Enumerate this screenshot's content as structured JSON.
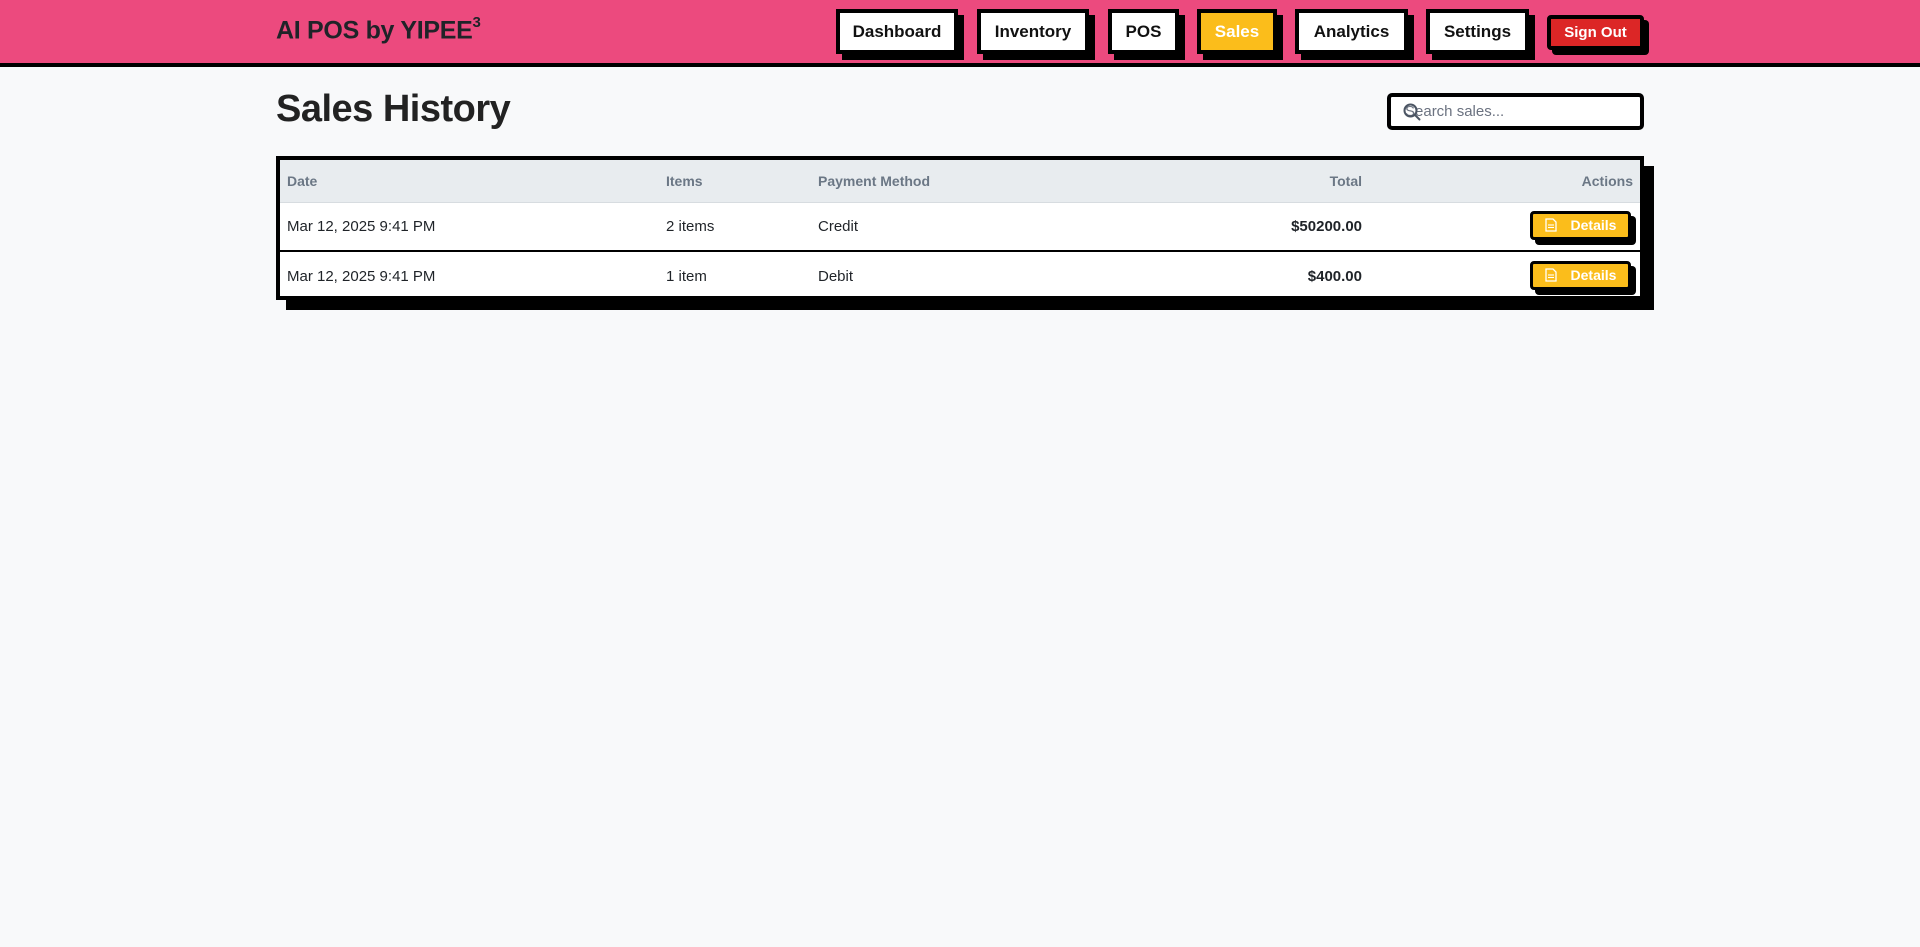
{
  "brand": {
    "name": "AI POS by YIPEE",
    "superscript": "3"
  },
  "nav": {
    "items": [
      {
        "label": "Dashboard",
        "active": false
      },
      {
        "label": "Inventory",
        "active": false
      },
      {
        "label": "POS",
        "active": false
      },
      {
        "label": "Sales",
        "active": true
      },
      {
        "label": "Analytics",
        "active": false
      },
      {
        "label": "Settings",
        "active": false
      }
    ],
    "sign_out_label": "Sign Out"
  },
  "page": {
    "title": "Sales History"
  },
  "search": {
    "placeholder": "Search sales...",
    "value": "",
    "icon": "search-icon"
  },
  "table": {
    "headers": [
      "Date",
      "Items",
      "Payment Method",
      "Total",
      "Actions"
    ],
    "rows": [
      {
        "date": "Mar 12, 2025 9:41 PM",
        "items": "2 items",
        "payment": "Credit",
        "total": "$50200.00",
        "action_label": "Details"
      },
      {
        "date": "Mar 12, 2025 9:41 PM",
        "items": "1 item",
        "payment": "Debit",
        "total": "$400.00",
        "action_label": "Details"
      }
    ]
  },
  "colors": {
    "header_bg": "#ec4a7e",
    "accent_yellow": "#fbbd1b",
    "danger_red": "#dc2626",
    "border_black": "#000000",
    "page_bg": "#f8f9fa"
  }
}
